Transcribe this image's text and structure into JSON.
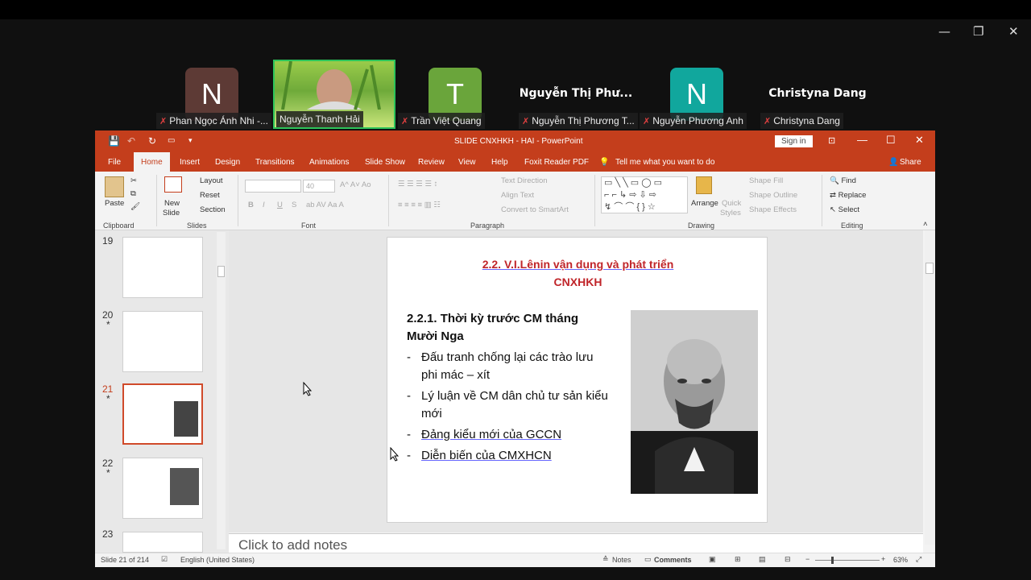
{
  "meeting": {
    "window_controls": {
      "minimize": "—",
      "restore": "❐",
      "close": "✕"
    },
    "participants": [
      {
        "avatar_letter": "N",
        "avatar_color": "#5d3a35",
        "name": "Phan Ngọc Ánh Nhi -..."
      },
      {
        "avatar_letter": "",
        "avatar_color": "",
        "name": "Nguyễn Thanh Hải"
      },
      {
        "avatar_letter": "T",
        "avatar_color": "#6aa53b",
        "name": "Trần Việt Quang"
      },
      {
        "display_name": "Nguyễn Thị Phư...",
        "name": "Nguyễn Thị Phương T..."
      },
      {
        "avatar_letter": "N",
        "avatar_color": "#11a79d",
        "name": "Nguyễn Phương Anh"
      },
      {
        "display_name": "Christyna Dang",
        "name": "Christyna Dang"
      }
    ]
  },
  "ppt": {
    "title": "SLIDE CNXHKH - HAI  -  PowerPoint",
    "sign_in": "Sign in",
    "share": "Share",
    "tell_me": "Tell me what you want to do",
    "tabs": [
      "File",
      "Home",
      "Insert",
      "Design",
      "Transitions",
      "Animations",
      "Slide Show",
      "Review",
      "View",
      "Help",
      "Foxit Reader PDF"
    ],
    "ribbon": {
      "clipboard": {
        "paste": "Paste",
        "label": "Clipboard"
      },
      "slides": {
        "new_slide_1": "New",
        "new_slide_2": "Slide",
        "layout": "Layout",
        "reset": "Reset",
        "section": "Section",
        "label": "Slides"
      },
      "font": {
        "size": "40",
        "bold": "B",
        "italic": "I",
        "underline": "U",
        "strike": "S",
        "label": "Font"
      },
      "paragraph": {
        "text_direction": "Text Direction",
        "align_text": "Align Text",
        "convert": "Convert to SmartArt",
        "label": "Paragraph"
      },
      "drawing": {
        "arrange": "Arrange",
        "quick_styles_1": "Quick",
        "quick_styles_2": "Styles",
        "shape_fill": "Shape Fill",
        "shape_outline": "Shape Outline",
        "shape_effects": "Shape Effects",
        "label": "Drawing"
      },
      "editing": {
        "find": "Find",
        "replace": "Replace",
        "select": "Select",
        "label": "Editing"
      }
    },
    "thumbnails": [
      {
        "num": "19",
        "star": ""
      },
      {
        "num": "20",
        "star": "*"
      },
      {
        "num": "21",
        "star": "*"
      },
      {
        "num": "22",
        "star": "*"
      },
      {
        "num": "23",
        "star": ""
      }
    ],
    "slide": {
      "title_line1": "2.2. V.I.Lênin vận dụng và phát triển",
      "title_line2": "CNXHKH",
      "heading_line1": "2.2.1. Thời kỳ trước CM tháng",
      "heading_line2": "Mười Nga",
      "bullets": [
        {
          "l1": "Đấu tranh chống lại các trào lưu",
          "l2": "phi mác – xít"
        },
        {
          "l1": "Lý luận về CM dân chủ tư sản kiểu",
          "l2": "mới"
        },
        {
          "l1": " Đảng kiểu mới của GCCN",
          "l2": ""
        },
        {
          "l1": "Diễn biến của CMXHCN",
          "l2": ""
        }
      ],
      "dash": "-"
    },
    "notes_placeholder": "Click to add notes",
    "status": {
      "slide_count": "Slide 21 of 214",
      "language": "English (United States)",
      "notes": "Notes",
      "comments": "Comments",
      "zoom": "63%"
    }
  }
}
